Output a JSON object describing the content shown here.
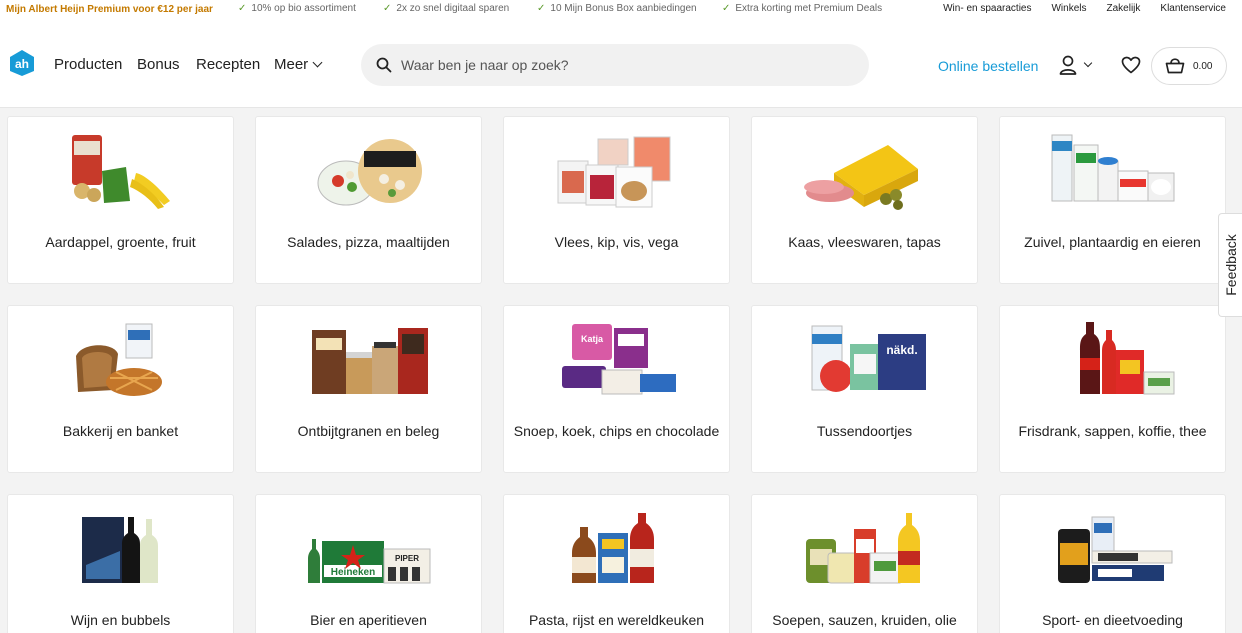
{
  "promo": {
    "premium": "Mijn Albert Heijn Premium voor €12 per jaar",
    "usps": [
      "10% op bio assortiment",
      "2x zo snel digitaal sparen",
      "10 Mijn Bonus Box aanbiedingen",
      "Extra korting met Premium Deals"
    ],
    "links": [
      "Win- en spaaracties",
      "Winkels",
      "Zakelijk",
      "Klantenservice"
    ]
  },
  "header": {
    "nav": [
      "Producten",
      "Bonus",
      "Recepten",
      "Meer"
    ],
    "search_placeholder": "Waar ben je naar op zoek?",
    "online": "Online bestellen",
    "cart_total": "0.00"
  },
  "colors": {
    "brand": "#179bd7",
    "premium": "#c47a00",
    "check": "#5c9b2c"
  },
  "categories": [
    "Aardappel, groente, fruit",
    "Salades, pizza, maaltijden",
    "Vlees, kip, vis, vega",
    "Kaas, vleeswaren, tapas",
    "Zuivel, plantaardig en eieren",
    "Bakkerij en banket",
    "Ontbijtgranen en beleg",
    "Snoep, koek, chips en chocolade",
    "Tussendoortjes",
    "Frisdrank, sappen, koffie, thee",
    "Wijn en bubbels",
    "Bier en aperitieven",
    "Pasta, rijst en wereldkeuken",
    "Soepen, sauzen, kruiden, olie",
    "Sport- en dieetvoeding"
  ],
  "feedback": "Feedback"
}
